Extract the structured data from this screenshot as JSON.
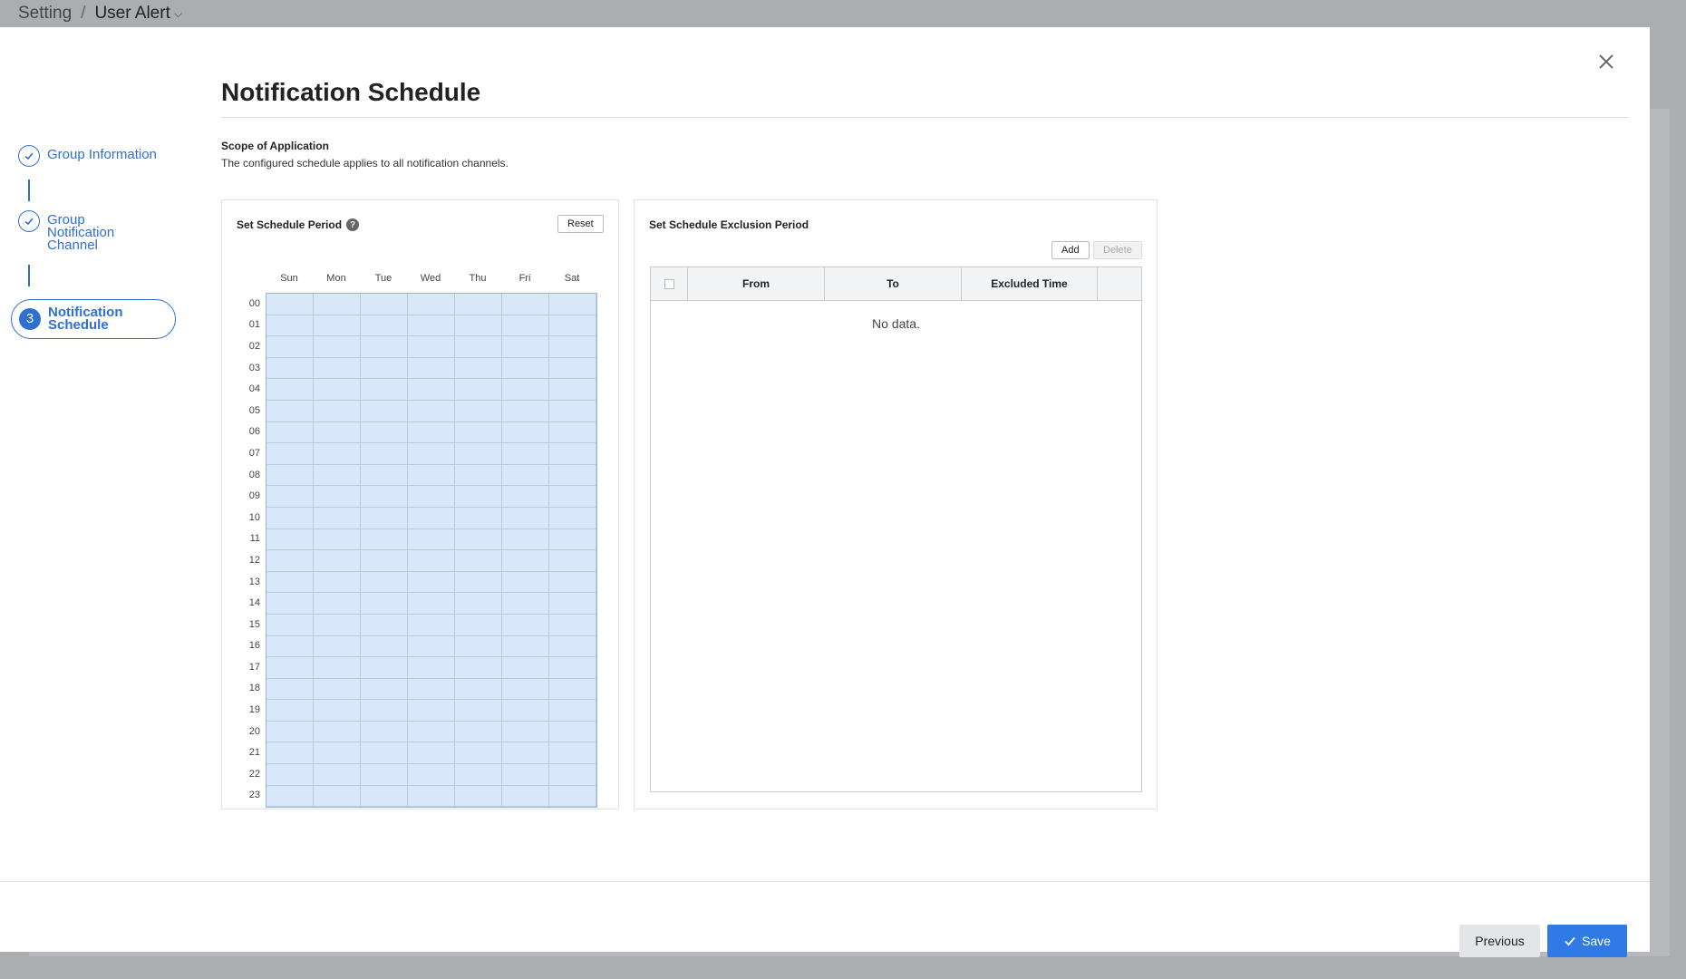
{
  "breadcrumb": {
    "parent": "Setting",
    "current": "User Alert"
  },
  "modal": {
    "title": "Notification Schedule",
    "scope_label": "Scope of Application",
    "scope_description": "The configured schedule applies to all notification channels."
  },
  "steps": [
    {
      "label": "Group Information",
      "status": "done"
    },
    {
      "label": "Group Notification Channel",
      "status": "done"
    },
    {
      "number": "3",
      "label": "Notification Schedule",
      "status": "active"
    }
  ],
  "schedule": {
    "title": "Set Schedule Period",
    "reset_label": "Reset",
    "help_glyph": "?",
    "days": [
      "Sun",
      "Mon",
      "Tue",
      "Wed",
      "Thu",
      "Fri",
      "Sat"
    ],
    "hours": [
      "00",
      "01",
      "02",
      "03",
      "04",
      "05",
      "06",
      "07",
      "08",
      "09",
      "10",
      "11",
      "12",
      "13",
      "14",
      "15",
      "16",
      "17",
      "18",
      "19",
      "20",
      "21",
      "22",
      "23"
    ]
  },
  "exclusion": {
    "title": "Set Schedule Exclusion Period",
    "add_label": "Add",
    "delete_label": "Delete",
    "columns": [
      "From",
      "To",
      "Excluded Time"
    ],
    "empty_text": "No data."
  },
  "footer": {
    "previous_label": "Previous",
    "save_label": "Save"
  },
  "colors": {
    "accent": "#2f7ae5",
    "step": "#2f6fd0",
    "cell": "#d9e7fb"
  },
  "icons": {
    "close": "close-icon",
    "check": "check-icon",
    "help": "help-icon",
    "chevron": "chevron-down-icon"
  }
}
